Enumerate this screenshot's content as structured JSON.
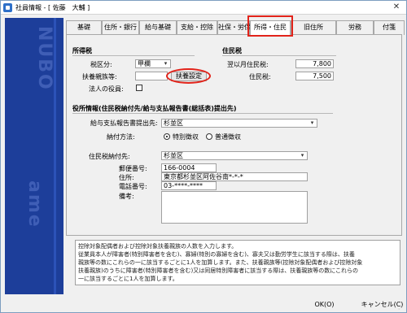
{
  "window": {
    "title": "社員情報 - [ 佐藤　大輔 ]",
    "close_glyph": "✕"
  },
  "sidepanel": {
    "watermark_top": "NUBO",
    "watermark_bottom": "ame"
  },
  "tabs": [
    "基礎",
    "住所・銀行",
    "給与基礎",
    "支給・控除",
    "社保・労保",
    "所得・住民",
    "旧住所",
    "労務",
    "付箋"
  ],
  "active_tab": "所得・住民",
  "highlight_color": "#e2231a",
  "income_tax": {
    "heading": "所得税",
    "tax_class_label": "税区分:",
    "tax_class_value": "甲欄",
    "dependents_label": "扶養親族等:",
    "dependents_value": "",
    "dependents_button": "扶養設定",
    "officer_label": "法人の役員:"
  },
  "resident_tax": {
    "heading": "住民税",
    "monthly_label": "翌以月住民税:",
    "monthly_value": "7,800",
    "tax_label": "住民税:",
    "tax_value": "7,500"
  },
  "office_info": {
    "heading": "役所情報(住民税納付先/給与支払報告書(総括表)提出先)",
    "report_dest_label": "給与支払報告書提出先:",
    "report_dest_value": "杉並区",
    "payment_method_label": "納付方法:",
    "payment_options": [
      "特別徴収",
      "普通徴収"
    ],
    "payment_selected": "特別徴収",
    "payee_label": "住民税納付先:",
    "payee_value": "杉並区",
    "postal_label": "郵便番号:",
    "postal_value": "166-0004",
    "address_label": "住所:",
    "address_value": "東京都杉並区阿佐谷南*-*-*",
    "phone_label": "電話番号:",
    "phone_value": "03-****-****",
    "notes_label": "備考:"
  },
  "help_text": [
    "控除対象配偶者および控除対象扶養親族の人数を入力します。",
    "従業員本人が障害者(特別障害者を含む)、寡婦(特別の寡婦を含む)、寡夫又は勤労学生に該当する際は、扶養",
    "親族等の数にこれらの一に該当するごとに1人を加算します。また、扶養親族等(控除対象配偶者および控除対象",
    "扶養親族)のうちに障害者(特別障害者を含む)又は同居特別障害者に該当する際は、扶養親族等の数にこれらの",
    "一に該当するごとに1人を加算します。"
  ],
  "footer": {
    "ok_label": "OK(O)",
    "cancel_label": "キャンセル(C)"
  }
}
